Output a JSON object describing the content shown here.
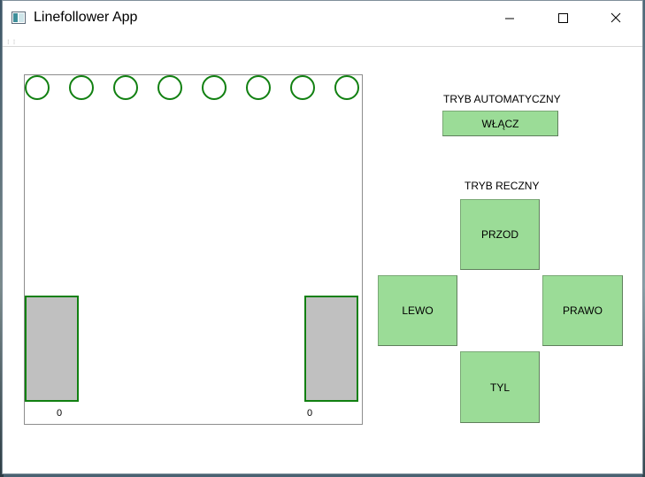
{
  "window": {
    "title": "Linefollower App"
  },
  "icons": {
    "app": "app-window-icon",
    "minimize": "minimize-icon",
    "maximize": "maximize-icon",
    "close": "close-icon"
  },
  "colors": {
    "button_green": "#9bdc97",
    "sensor_outline": "#118011",
    "wheel_fill": "#c0c0c0"
  },
  "robot": {
    "sensors": [
      {
        "id": 1,
        "active": false
      },
      {
        "id": 2,
        "active": false
      },
      {
        "id": 3,
        "active": false
      },
      {
        "id": 4,
        "active": false
      },
      {
        "id": 5,
        "active": false
      },
      {
        "id": 6,
        "active": false
      },
      {
        "id": 7,
        "active": false
      },
      {
        "id": 8,
        "active": false
      }
    ],
    "left_wheel_value": "0",
    "right_wheel_value": "0"
  },
  "auto_mode": {
    "label": "TRYB AUTOMATYCZNY",
    "enable_button": "WŁĄCZ"
  },
  "manual_mode": {
    "label": "TRYB RECZNY",
    "forward": "PRZOD",
    "left": "LEWO",
    "right": "PRAWO",
    "backward": "TYL"
  }
}
